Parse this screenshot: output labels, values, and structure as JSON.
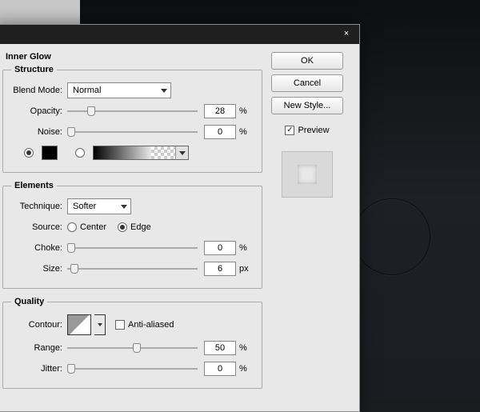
{
  "dialog": {
    "title": "Inner Glow",
    "close_glyph": "×",
    "structure": {
      "legend": "Structure",
      "blend_mode_label": "Blend Mode:",
      "blend_mode_value": "Normal",
      "opacity_label": "Opacity:",
      "opacity_value": "28",
      "opacity_unit": "%",
      "noise_label": "Noise:",
      "noise_value": "0",
      "noise_unit": "%"
    },
    "elements": {
      "legend": "Elements",
      "technique_label": "Technique:",
      "technique_value": "Softer",
      "source_label": "Source:",
      "source_center": "Center",
      "source_edge": "Edge",
      "source_selected": "edge",
      "choke_label": "Choke:",
      "choke_value": "0",
      "choke_unit": "%",
      "size_label": "Size:",
      "size_value": "6",
      "size_unit": "px"
    },
    "quality": {
      "legend": "Quality",
      "contour_label": "Contour:",
      "antialiased_label": "Anti-aliased",
      "antialiased_checked": false,
      "range_label": "Range:",
      "range_value": "50",
      "range_unit": "%",
      "jitter_label": "Jitter:",
      "jitter_value": "0",
      "jitter_unit": "%"
    },
    "buttons": {
      "ok": "OK",
      "cancel": "Cancel",
      "new_style": "New Style...",
      "preview": "Preview",
      "preview_checked": true
    }
  }
}
